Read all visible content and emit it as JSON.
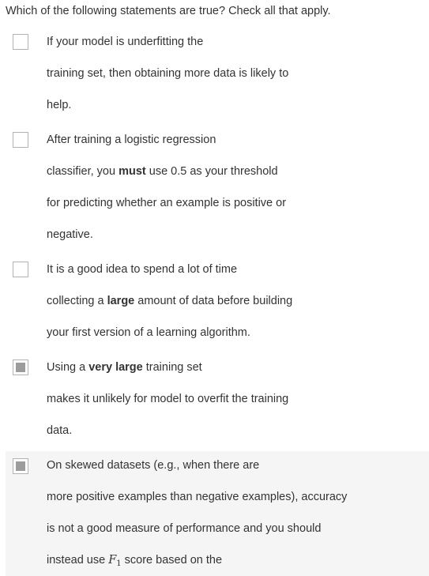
{
  "question": "Which of the following statements are true? Check all that apply.",
  "options": [
    {
      "checked": false,
      "lines": [
        [
          "If your model is underfitting the"
        ],
        [
          "training set, then obtaining more data is likely to"
        ],
        [
          "help."
        ]
      ]
    },
    {
      "checked": false,
      "lines": [
        [
          "After training a logistic regression"
        ],
        [
          "classifier, you ",
          "must",
          " use 0.5 as your threshold"
        ],
        [
          "for predicting whether an example is positive or"
        ],
        [
          "negative."
        ]
      ]
    },
    {
      "checked": false,
      "lines": [
        [
          "It is a good idea to spend a lot of time"
        ],
        [
          "collecting a ",
          "large",
          " amount of data before building"
        ],
        [
          "your first version of a learning algorithm."
        ]
      ]
    },
    {
      "checked": true,
      "lines": [
        [
          "Using a ",
          "very large",
          " training set"
        ],
        [
          "makes it unlikely for model to overfit the training"
        ],
        [
          "data."
        ]
      ]
    },
    {
      "checked": true,
      "lines": [
        [
          "On skewed datasets (e.g., when there are"
        ],
        [
          "more positive examples than negative examples), accuracy"
        ],
        [
          "is not a good measure of performance and you should"
        ],
        [
          "instead use ",
          "F",
          "1",
          " score based on the"
        ]
      ]
    }
  ]
}
